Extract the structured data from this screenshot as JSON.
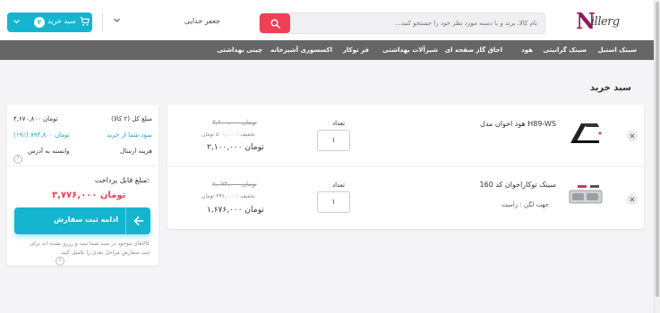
{
  "header": {
    "logo_mark": "N",
    "logo_rest": "illerg",
    "search_placeholder": "نام کالا، برند و یا دسته مورد نظر خود را جستجو کنید...",
    "user_name": "جعفر خدایی",
    "cart_label": "سبد خرید",
    "cart_count": "۲"
  },
  "nav": {
    "items": [
      "سینک استیل",
      "سینک گرانیتی",
      "هود",
      "اجاق گاز صفحه ای",
      "شیرآلات بهداشتی",
      "فر توکار",
      "اکسسوری آشپزخانه",
      "چینی بهداشتی"
    ]
  },
  "page_title": "سبد خرید",
  "cart": {
    "qty_label": "تعداد",
    "items": [
      {
        "name": "هود اخوان مدل H89-WS",
        "attr": "",
        "qty": "۱",
        "old_price": "۳,۲۰۰,۰۰۰ تومان",
        "discount": "تخفیف : ۵۰۰,۰۰۰ تومان",
        "final_price": "۲,۱۰۰,۰۰۰ تومان"
      },
      {
        "name": "سینک توکاراخوان کد 160",
        "attr": "جهت لگن :   راست",
        "qty": "۱",
        "old_price": "۲,۰۷۳,۰۰۰ تومان",
        "discount": "تخفیف : ۳۹۶,۰۰۰ تومان",
        "final_price": "۱,۶۷۶,۰۰۰ تومان"
      }
    ]
  },
  "summary": {
    "total_label": "مبلغ کل (۲ کالا)",
    "total_value": "۴,۶۷۰,۸۰۰ تومان",
    "profit_label": "سود شما از خرید",
    "profit_value": "(۱۹٪) ۸۹۴,۸۰۰ تومان",
    "shipping_label": "هزینه ارسال",
    "shipping_value": "وابسته به آدرس",
    "pay_label": "مبلغ قابل پرداخت:",
    "pay_value": "۳,۷۷۶,۰۰۰ تومان",
    "continue_label": "ادامه ثبت سفارش",
    "note": "کالاهای موجود در سبد شما ثبت و رزرو نشده اند برای ثبت سفارش مراحل بعدی را تکمیل کنید."
  },
  "colors": {
    "accent": "#15b5d0",
    "danger": "#ef4056",
    "nav_bg": "#666666"
  }
}
